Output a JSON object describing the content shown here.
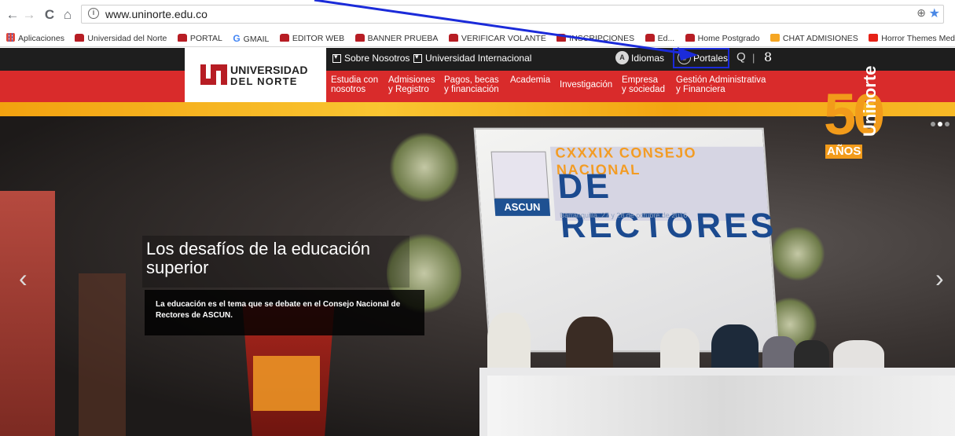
{
  "browser": {
    "nav_back": "←",
    "nav_forward": "→",
    "nav_reload": "C",
    "nav_home": "⌂",
    "url": "www.uninorte.edu.co",
    "zoom_icon": "magnifier-icon",
    "bookmark_star": "★",
    "bookmarks": [
      {
        "label": "Aplicaciones",
        "icon": "apps"
      },
      {
        "label": "Universidad del Norte",
        "icon": "un"
      },
      {
        "label": "PORTAL",
        "icon": "un"
      },
      {
        "label": "GMAIL",
        "icon": "g"
      },
      {
        "label": "EDITOR WEB",
        "icon": "un"
      },
      {
        "label": "BANNER PRUEBA",
        "icon": "un"
      },
      {
        "label": "VERIFICAR VOLANTE",
        "icon": "un"
      },
      {
        "label": "INSCRIPCIONES",
        "icon": "un"
      },
      {
        "label": "Ed...",
        "icon": "un"
      },
      {
        "label": "Home Postgrado",
        "icon": "un"
      },
      {
        "label": "CHAT ADMISIONES",
        "icon": "orange"
      },
      {
        "label": "Horror Themes Medle",
        "icon": "yt"
      }
    ]
  },
  "site": {
    "logo_line1": "UNIVERSIDAD",
    "logo_line2": "DEL NORTE",
    "top_links": {
      "sobre": "Sobre Nosotros",
      "internacional": "Universidad Internacional",
      "idiomas_badge": "A",
      "idiomas": "Idiomas",
      "portales": "Portales",
      "search_glyph": "Q",
      "separator": "|",
      "g_glyph": "8"
    },
    "menu": [
      {
        "line1": "Estudia con",
        "line2": "nosotros"
      },
      {
        "line1": "Admisiones",
        "line2": "y Registro"
      },
      {
        "line1": "Pagos, becas",
        "line2": "y financiación"
      },
      {
        "line1": "Academia",
        "line2": ""
      },
      {
        "line1": "Investigación",
        "line2": ""
      },
      {
        "line1": "Empresa",
        "line2": "y sociedad"
      },
      {
        "line1": "Gestión Administrativa",
        "line2": "y Financiera"
      }
    ],
    "hero": {
      "title_line1": "Los desafíos de la educación",
      "title_line2": "superior",
      "description": "La educación es el tema que se debate en el Consejo Nacional de Rectores de ASCUN.",
      "screen_line1": "CXXXIX CONSEJO NACIONAL",
      "screen_line2": "DE RECTORES",
      "screen_line3": "Barranquilla, 27 y 28 de octubre de 2016",
      "screen_org": "ASCUN",
      "arrow_left": "‹",
      "arrow_right": "›",
      "badge_number": "50",
      "badge_anos": "AÑOS",
      "badge_brand": "Uninorte"
    }
  },
  "colors": {
    "topbar": "#1e1e1e",
    "redbar": "#d92b2b",
    "gold": "#f2a10f",
    "highlight": "#1b2bd9",
    "brand_red": "#b71d24"
  }
}
